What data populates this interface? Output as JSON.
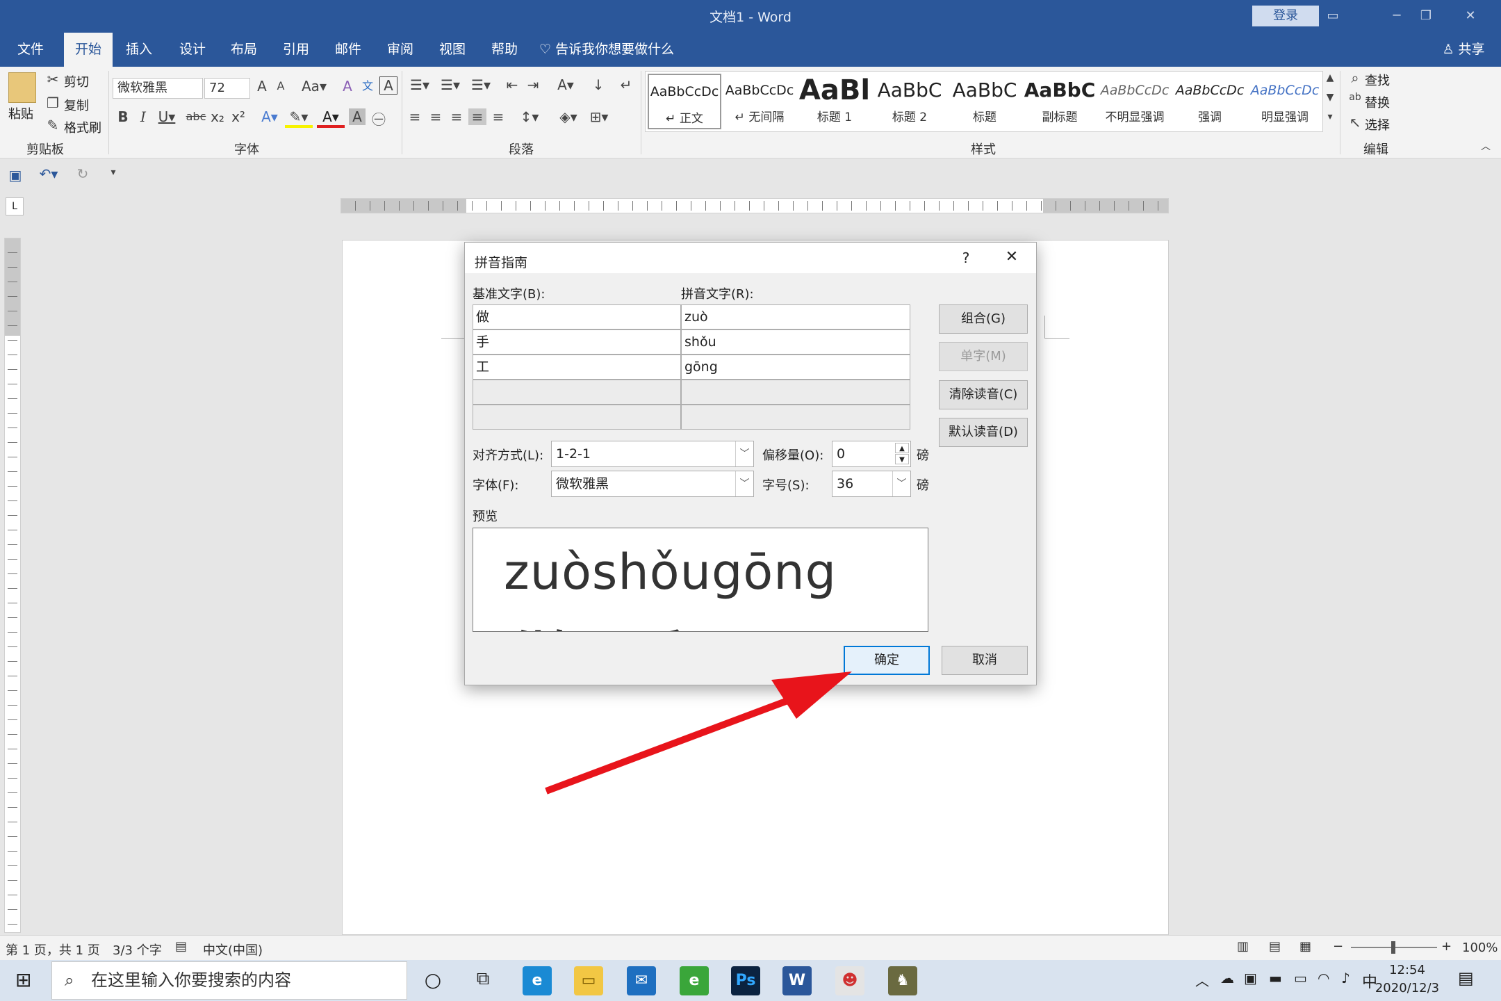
{
  "titlebar": {
    "title": "文档1  -  Word",
    "login": "登录"
  },
  "tabs": [
    "文件",
    "开始",
    "插入",
    "设计",
    "布局",
    "引用",
    "邮件",
    "审阅",
    "视图",
    "帮助",
    "告诉我你想要做什么"
  ],
  "share": "共享",
  "ribbon": {
    "clipboard": {
      "paste": "粘贴",
      "cut": "剪切",
      "copy": "复制",
      "format_painter": "格式刷",
      "label": "剪贴板"
    },
    "font": {
      "family": "微软雅黑",
      "size": "72",
      "label": "字体"
    },
    "paragraph": {
      "label": "段落"
    },
    "styles": {
      "items": [
        {
          "preview": "AaBbCcDc",
          "name": "↵ 正文"
        },
        {
          "preview": "AaBbCcDc",
          "name": "↵ 无间隔"
        },
        {
          "preview": "AaBl",
          "name": "标题 1"
        },
        {
          "preview": "AaBbC",
          "name": "标题 2"
        },
        {
          "preview": "AaBbC",
          "name": "标题"
        },
        {
          "preview": "AaBbC",
          "name": "副标题"
        },
        {
          "preview": "AaBbCcDc",
          "name": "不明显强调"
        },
        {
          "preview": "AaBbCcDc",
          "name": "强调"
        },
        {
          "preview": "AaBbCcDc",
          "name": "明显强调"
        }
      ],
      "label": "样式"
    },
    "editing": {
      "find": "查找",
      "replace": "替换",
      "select": "选择",
      "label": "编辑"
    }
  },
  "dialog": {
    "title": "拼音指南",
    "help": "?",
    "base_label": "基准文字(B):",
    "pinyin_label": "拼音文字(R):",
    "rows": [
      {
        "base": "做",
        "pinyin": "zuò"
      },
      {
        "base": "手",
        "pinyin": "shǒu"
      },
      {
        "base": "工",
        "pinyin": "gōng"
      },
      {
        "base": "",
        "pinyin": ""
      },
      {
        "base": "",
        "pinyin": ""
      }
    ],
    "buttons": {
      "group": "组合(G)",
      "mono": "单字(M)",
      "clear": "清除读音(C)",
      "default": "默认读音(D)",
      "ok": "确定",
      "cancel": "取消"
    },
    "align_label": "对齐方式(L):",
    "align_value": "1-2-1",
    "offset_label": "偏移量(O):",
    "offset_value": "0",
    "font_label": "字体(F):",
    "font_value": "微软雅黑",
    "size_label": "字号(S):",
    "size_value": "36",
    "unit": "磅",
    "preview_label": "预览",
    "preview_pinyin": "zuòshǒugōng",
    "preview_base": "做手工"
  },
  "statusbar": {
    "page": "第 1 页，共 1 页",
    "words": "3/3 个字",
    "lang": "中文(中国)",
    "zoom": "100%"
  },
  "taskbar": {
    "search_placeholder": "在这里输入你要搜索的内容",
    "time": "12:54",
    "date": "2020/12/3",
    "ime": "中"
  },
  "colors": {
    "word_blue": "#2b579a",
    "arrow_red": "#e8141b",
    "ok_border": "#0078d7"
  }
}
